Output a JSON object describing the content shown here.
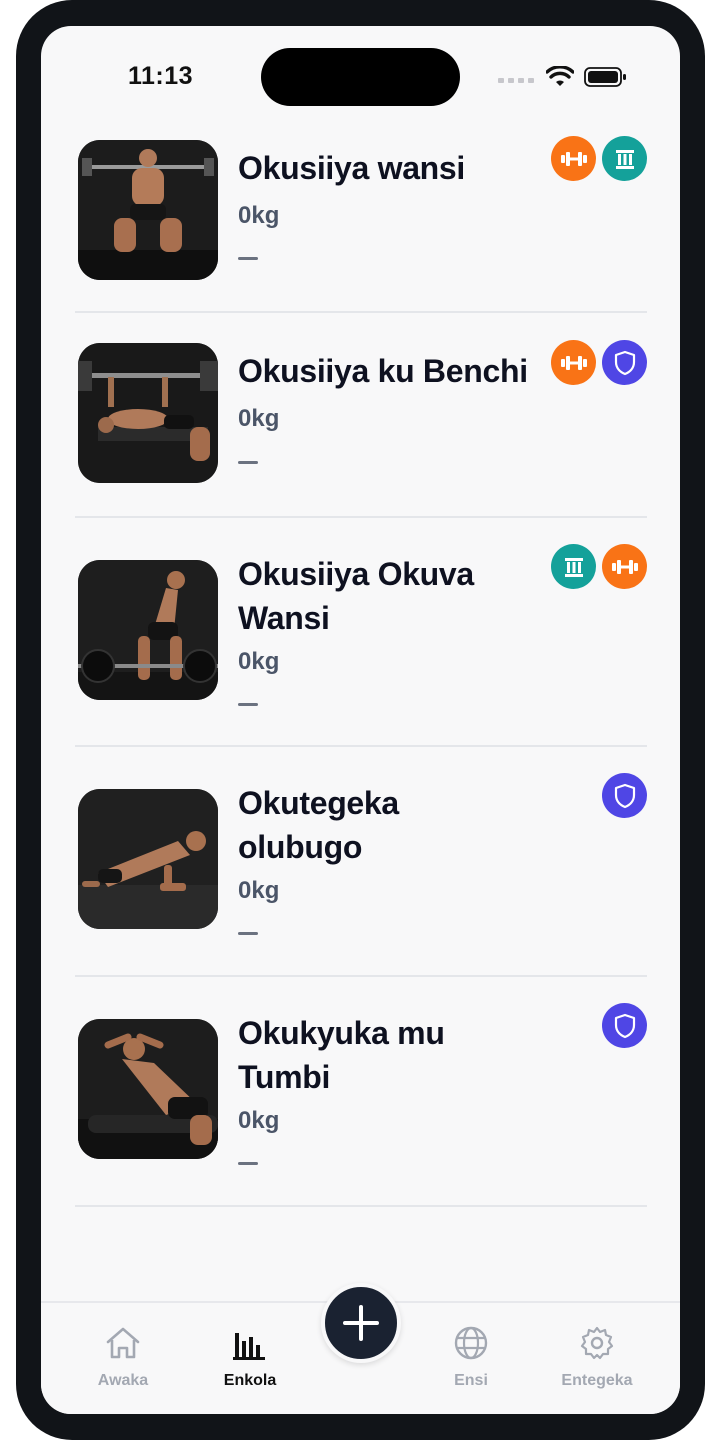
{
  "status_bar": {
    "time": "11:13"
  },
  "exercises": [
    {
      "name": "Okusiiya wansi",
      "weight": "0kg",
      "last": "—",
      "tags": [
        "dumbbell-icon",
        "pillar-icon"
      ]
    },
    {
      "name": "Okusiiya ku Benchi",
      "weight": "0kg",
      "last": "—",
      "tags": [
        "dumbbell-icon",
        "shield-icon"
      ]
    },
    {
      "name": "Okusiiya Okuva Wansi",
      "weight": "0kg",
      "last": "—",
      "tags": [
        "pillar-icon",
        "dumbbell-icon"
      ]
    },
    {
      "name": "Okutegeka olubugo",
      "weight": "0kg",
      "last": "—",
      "tags": [
        "shield-icon"
      ]
    },
    {
      "name": "Okukyuka mu Tumbi",
      "weight": "0kg",
      "last": "—",
      "tags": [
        "shield-icon"
      ]
    }
  ],
  "nav": {
    "home": "Awaka",
    "stats": "Enkola",
    "world": "Ensi",
    "settings": "Entegeka",
    "active": "stats"
  },
  "colors": {
    "dumbbell_badge": "#f97316",
    "pillar_badge": "#14a19a",
    "shield_badge": "#4f46e5",
    "fab": "#1a2231"
  }
}
